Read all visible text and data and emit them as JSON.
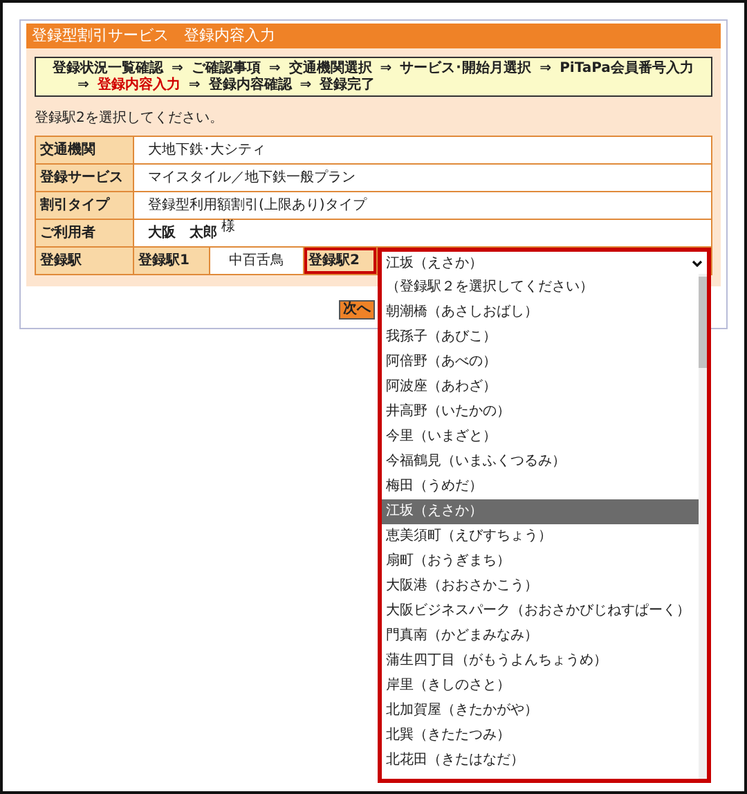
{
  "header": {
    "title": "登録型割引サービス　登録内容入力"
  },
  "breadcrumb": {
    "separator": "⇒",
    "lines": [
      [
        {
          "label": "登録状況一覧確認",
          "current": false
        },
        {
          "label": "ご確認事項",
          "current": false
        },
        {
          "label": "交通機関選択",
          "current": false
        },
        {
          "label": "サービス･開始月選択",
          "current": false
        },
        {
          "label": "PiTaPa会員番号入力",
          "current": false
        }
      ],
      [
        {
          "label": "登録内容入力",
          "current": true
        },
        {
          "label": "登録内容確認",
          "current": false
        },
        {
          "label": "登録完了",
          "current": false
        }
      ]
    ]
  },
  "instruction": "登録駅2を選択してください。",
  "rows": [
    {
      "kind": "text",
      "label": "交通機関",
      "value": "大地下鉄･大シティ"
    },
    {
      "kind": "text",
      "label": "登録サービス",
      "value": "マイスタイル／地下鉄一般プラン"
    },
    {
      "kind": "text",
      "label": "割引タイプ",
      "value": "登録型利用額割引(上限あり)タイプ"
    },
    {
      "kind": "name",
      "label": "ご利用者",
      "value": "大阪　太郎",
      "honorific": "様"
    },
    {
      "kind": "stations",
      "label": "登録駅",
      "station1": {
        "label": "登録駅1",
        "value": "中百舌鳥"
      },
      "station2": {
        "label": "登録駅2",
        "value": "江坂（えさか）",
        "open": true,
        "options": [
          {
            "label": "（登録駅２を選択してください）",
            "selected": false
          },
          {
            "label": "朝潮橋（あさしおばし）",
            "selected": false
          },
          {
            "label": "我孫子（あびこ）",
            "selected": false
          },
          {
            "label": "阿倍野（あべの）",
            "selected": false
          },
          {
            "label": "阿波座（あわざ）",
            "selected": false
          },
          {
            "label": "井高野（いたかの）",
            "selected": false
          },
          {
            "label": "今里（いまざと）",
            "selected": false
          },
          {
            "label": "今福鶴見（いまふくつるみ）",
            "selected": false
          },
          {
            "label": "梅田（うめだ）",
            "selected": false
          },
          {
            "label": "江坂（えさか）",
            "selected": true
          },
          {
            "label": "恵美須町（えびすちょう）",
            "selected": false
          },
          {
            "label": "扇町（おうぎまち）",
            "selected": false
          },
          {
            "label": "大阪港（おおさかこう）",
            "selected": false
          },
          {
            "label": "大阪ビジネスパーク（おおさかびじねすぱーく）",
            "selected": false
          },
          {
            "label": "門真南（かどまみなみ）",
            "selected": false
          },
          {
            "label": "蒲生四丁目（がもうよんちょうめ）",
            "selected": false
          },
          {
            "label": "岸里（きしのさと）",
            "selected": false
          },
          {
            "label": "北加賀屋（きたかがや）",
            "selected": false
          },
          {
            "label": "北巽（きたたつみ）",
            "selected": false
          },
          {
            "label": "北花田（きたはなだ）",
            "selected": false
          }
        ]
      }
    }
  ],
  "buttons": [
    {
      "label": "次へ"
    }
  ]
}
